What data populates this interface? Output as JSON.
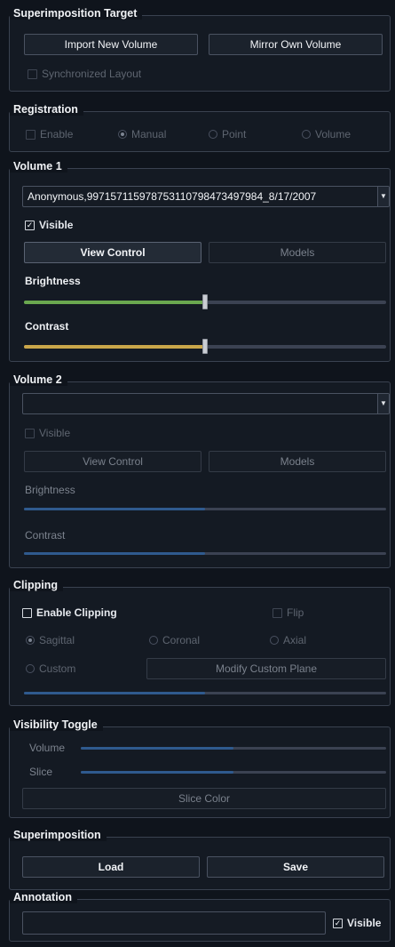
{
  "superimposition_target": {
    "title": "Superimposition Target",
    "import_button": "Import New Volume",
    "mirror_button": "Mirror Own Volume",
    "sync_layout": "Synchronized Layout"
  },
  "registration": {
    "title": "Registration",
    "enable": "Enable",
    "manual": "Manual",
    "point": "Point",
    "volume": "Volume"
  },
  "volume1": {
    "title": "Volume 1",
    "selected": "Anonymous,997157115978753110798473497984_8/17/2007",
    "visible": "Visible",
    "view_control": "View Control",
    "models": "Models",
    "brightness": "Brightness",
    "contrast": "Contrast",
    "brightness_value": 0.5,
    "contrast_value": 0.5,
    "brightness_color": "#6aa84f",
    "contrast_color": "#c9a64a"
  },
  "volume2": {
    "title": "Volume 2",
    "selected": "",
    "visible": "Visible",
    "view_control": "View Control",
    "models": "Models",
    "brightness": "Brightness",
    "contrast": "Contrast",
    "brightness_value": 0.5,
    "contrast_value": 0.5,
    "accent_color": "#2f5a8e"
  },
  "clipping": {
    "title": "Clipping",
    "enable": "Enable Clipping",
    "flip": "Flip",
    "sagittal": "Sagittal",
    "coronal": "Coronal",
    "axial": "Axial",
    "custom": "Custom",
    "modify_button": "Modify Custom Plane",
    "slider_value": 0.5
  },
  "visibility_toggle": {
    "title": "Visibility Toggle",
    "volume": "Volume",
    "slice": "Slice",
    "volume_value": 0.5,
    "slice_value": 0.5,
    "slice_color_button": "Slice Color"
  },
  "superimposition": {
    "title": "Superimposition",
    "load": "Load",
    "save": "Save"
  },
  "annotation": {
    "title": "Annotation",
    "text": "",
    "visible": "Visible"
  }
}
